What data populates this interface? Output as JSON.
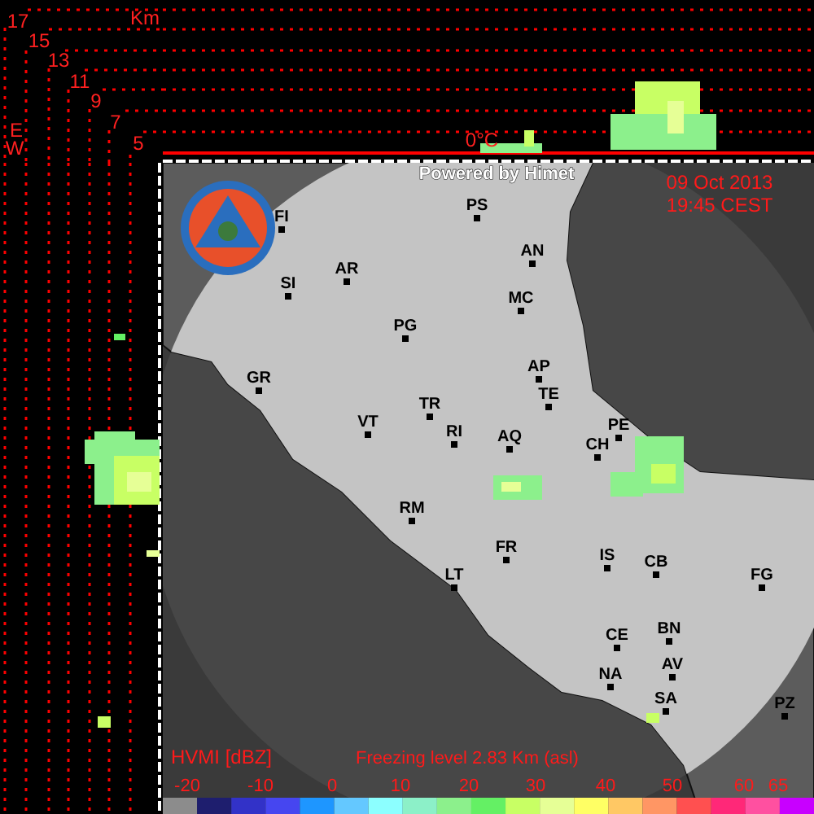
{
  "vertical_section": {
    "unit": "Km",
    "height_labels": [
      "17",
      "15",
      "13",
      "11",
      "9",
      "7",
      "5"
    ],
    "direction_labels": [
      "E",
      "W"
    ],
    "freezing_marker": "0°C"
  },
  "map": {
    "credit": "Powered by Himet",
    "date": "09 Oct 2013",
    "time": "19:45 CEST",
    "cities": [
      {
        "name": "FI"
      },
      {
        "name": "PS"
      },
      {
        "name": "AN"
      },
      {
        "name": "AR"
      },
      {
        "name": "SI"
      },
      {
        "name": "MC"
      },
      {
        "name": "PG"
      },
      {
        "name": "GR"
      },
      {
        "name": "AP"
      },
      {
        "name": "TE"
      },
      {
        "name": "TR"
      },
      {
        "name": "VT"
      },
      {
        "name": "RI"
      },
      {
        "name": "PE"
      },
      {
        "name": "AQ"
      },
      {
        "name": "CH"
      },
      {
        "name": "RM"
      },
      {
        "name": "FR"
      },
      {
        "name": "IS"
      },
      {
        "name": "CB"
      },
      {
        "name": "LT"
      },
      {
        "name": "FG"
      },
      {
        "name": "BN"
      },
      {
        "name": "CE"
      },
      {
        "name": "AV"
      },
      {
        "name": "NA"
      },
      {
        "name": "SA"
      },
      {
        "name": "PZ"
      }
    ]
  },
  "legend": {
    "product": "HVMI [dBZ]",
    "freezing_level": "Freezing level  2.83 Km (asl)",
    "ticks": [
      "-20",
      "-10",
      "0",
      "10",
      "20",
      "30",
      "40",
      "50",
      "60",
      "65"
    ],
    "swatches": [
      {
        "color": "#8c8c8c"
      },
      {
        "color": "#1e1e6e"
      },
      {
        "color": "#3232c8"
      },
      {
        "color": "#4646f0"
      },
      {
        "color": "#1e96ff"
      },
      {
        "color": "#64c8ff"
      },
      {
        "color": "#8cffff"
      },
      {
        "color": "#8cf0c8"
      },
      {
        "color": "#8cf08c"
      },
      {
        "color": "#64f064"
      },
      {
        "color": "#c8ff64"
      },
      {
        "color": "#e6ff96"
      },
      {
        "color": "#ffff64"
      },
      {
        "color": "#ffc864"
      },
      {
        "color": "#ff9664"
      },
      {
        "color": "#ff5050"
      },
      {
        "color": "#ff2878"
      },
      {
        "color": "#ff50a0"
      },
      {
        "color": "#c800ff"
      }
    ]
  }
}
